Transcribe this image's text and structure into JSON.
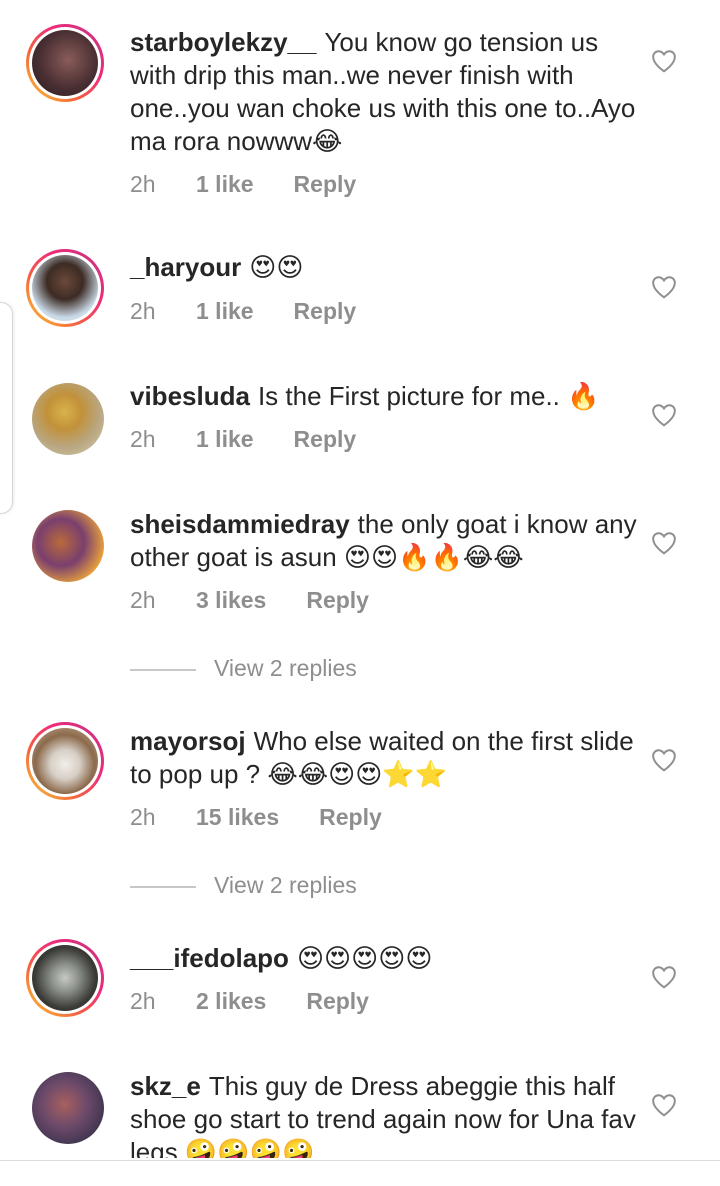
{
  "comments": [
    {
      "username": "starboylekzy__",
      "text": "You know go tension us with drip this man..we never finish with one..you wan choke us with this one to..Ayo ma rora nowww😂",
      "time": "2h",
      "likes": "1 like",
      "reply": "Reply"
    },
    {
      "username": "_haryour",
      "text": "😍😍",
      "time": "2h",
      "likes": "1 like",
      "reply": "Reply"
    },
    {
      "username": "vibesluda",
      "text": "Is the First picture for me.. 🔥",
      "time": "2h",
      "likes": "1 like",
      "reply": "Reply"
    },
    {
      "username": "sheisdammiedray",
      "text": "the only goat i know any other goat is asun 😍😍🔥🔥😂😂",
      "time": "2h",
      "likes": "3 likes",
      "reply": "Reply",
      "view_replies": "View 2 replies"
    },
    {
      "username": "mayorsoj",
      "text": "Who else waited on the first slide to pop up ? 😂😂😍😍⭐⭐",
      "time": "2h",
      "likes": "15 likes",
      "reply": "Reply",
      "view_replies": "View 2 replies"
    },
    {
      "username": "___ifedolapo",
      "text": "😍😍😍😍😍",
      "time": "2h",
      "likes": "2 likes",
      "reply": "Reply"
    },
    {
      "username": "skz_e",
      "text": "This guy de Dress abeggie this half shoe go start to trend again now for Una fav legs 🤪🤪🤪🤪"
    }
  ],
  "icons": {
    "like": "heart-outline-icon"
  },
  "colors": {
    "text": "#262626",
    "secondary": "#8e8e8e",
    "story_ring_start": "#f9ce34",
    "story_ring_end": "#c13584"
  }
}
